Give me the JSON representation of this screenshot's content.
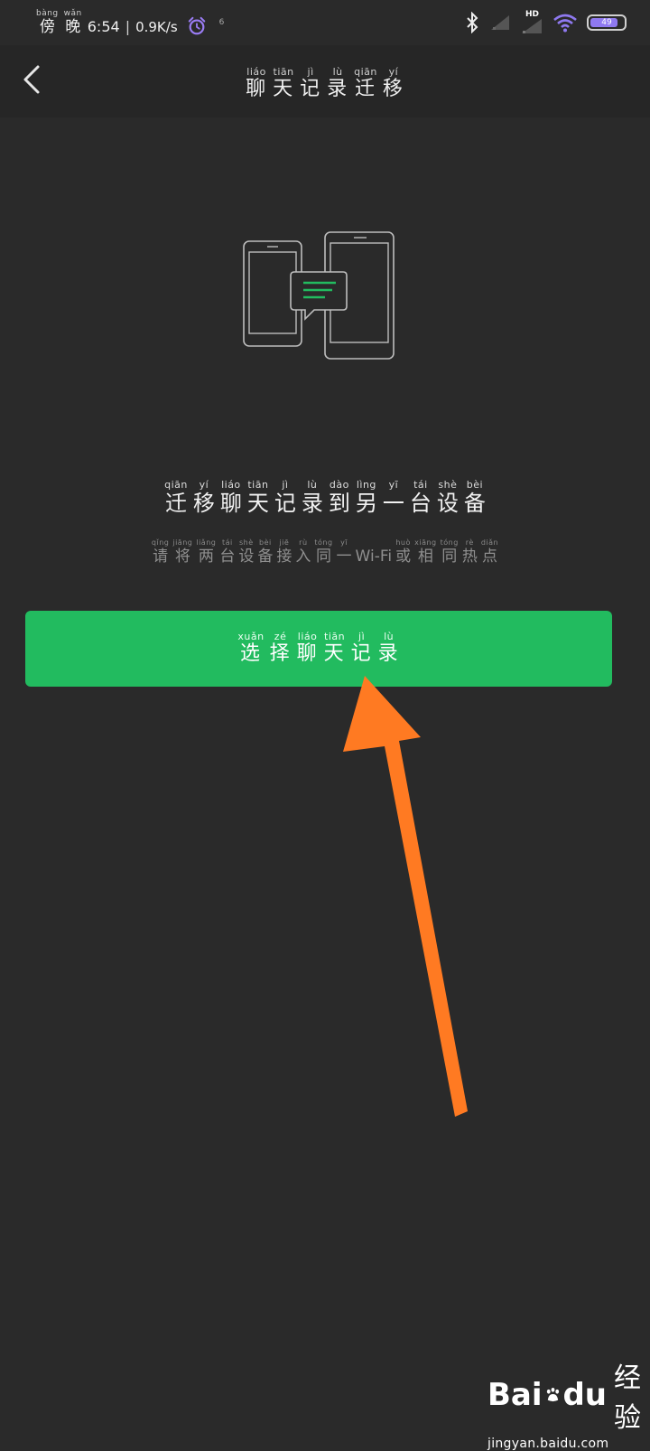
{
  "status_bar": {
    "period_pinyin": [
      "bàng",
      "wǎn"
    ],
    "period_chars": [
      "傍",
      "晚"
    ],
    "time": "6:54",
    "separator": "|",
    "net_speed": "0.9K/s",
    "alarm_icon": "alarm-clock-icon",
    "tiny_label": "6",
    "network_label": "HD",
    "battery_level": "49",
    "colors": {
      "battery_fill": "#8f79f0",
      "wifi": "#8f79f0"
    }
  },
  "nav": {
    "back_icon": "chevron-left-icon",
    "title": [
      {
        "py": "liáo",
        "hz": "聊"
      },
      {
        "py": "tiān",
        "hz": "天"
      },
      {
        "py": "jì",
        "hz": "记"
      },
      {
        "py": "lù",
        "hz": "录"
      },
      {
        "py": "qiān",
        "hz": "迁"
      },
      {
        "py": "yí",
        "hz": "移"
      }
    ]
  },
  "main": {
    "illustration_icon": "two-phones-chat-transfer-icon",
    "heading": [
      {
        "py": "qiān",
        "hz": "迁"
      },
      {
        "py": "yí",
        "hz": "移"
      },
      {
        "py": "liáo",
        "hz": "聊"
      },
      {
        "py": "tiān",
        "hz": "天"
      },
      {
        "py": "jì",
        "hz": "记"
      },
      {
        "py": "lù",
        "hz": "录"
      },
      {
        "py": "dào",
        "hz": "到"
      },
      {
        "py": "lìng",
        "hz": "另"
      },
      {
        "py": "yī",
        "hz": "一"
      },
      {
        "py": "tái",
        "hz": "台"
      },
      {
        "py": "shè",
        "hz": "设"
      },
      {
        "py": "bèi",
        "hz": "备"
      }
    ],
    "subheading_part1": [
      {
        "py": "qǐng",
        "hz": "请"
      },
      {
        "py": "jiāng",
        "hz": "将"
      },
      {
        "py": "liǎng",
        "hz": "两"
      },
      {
        "py": "tái",
        "hz": "台"
      },
      {
        "py": "shè",
        "hz": "设"
      },
      {
        "py": "bèi",
        "hz": "备"
      },
      {
        "py": "jiē",
        "hz": "接"
      },
      {
        "py": "rù",
        "hz": "入"
      },
      {
        "py": "tóng",
        "hz": "同"
      },
      {
        "py": "yī",
        "hz": "一"
      }
    ],
    "subheading_wifi": "Wi-Fi",
    "subheading_part2": [
      {
        "py": "huò",
        "hz": "或"
      },
      {
        "py": "xiāng",
        "hz": "相"
      },
      {
        "py": "tóng",
        "hz": "同"
      },
      {
        "py": "rè",
        "hz": "热"
      },
      {
        "py": "diǎn",
        "hz": "点"
      }
    ],
    "button": [
      {
        "py": "xuǎn",
        "hz": "选"
      },
      {
        "py": "zé",
        "hz": "择"
      },
      {
        "py": "liáo",
        "hz": "聊"
      },
      {
        "py": "tiān",
        "hz": "天"
      },
      {
        "py": "jì",
        "hz": "记"
      },
      {
        "py": "lù",
        "hz": "录"
      }
    ],
    "button_color": "#22bb5f",
    "annotation_arrow_color": "#ff7a22"
  },
  "watermark": {
    "brand_latin_1": "Bai",
    "brand_latin_2": "du",
    "brand_cn": "经验",
    "url": "jingyan.baidu.com"
  }
}
